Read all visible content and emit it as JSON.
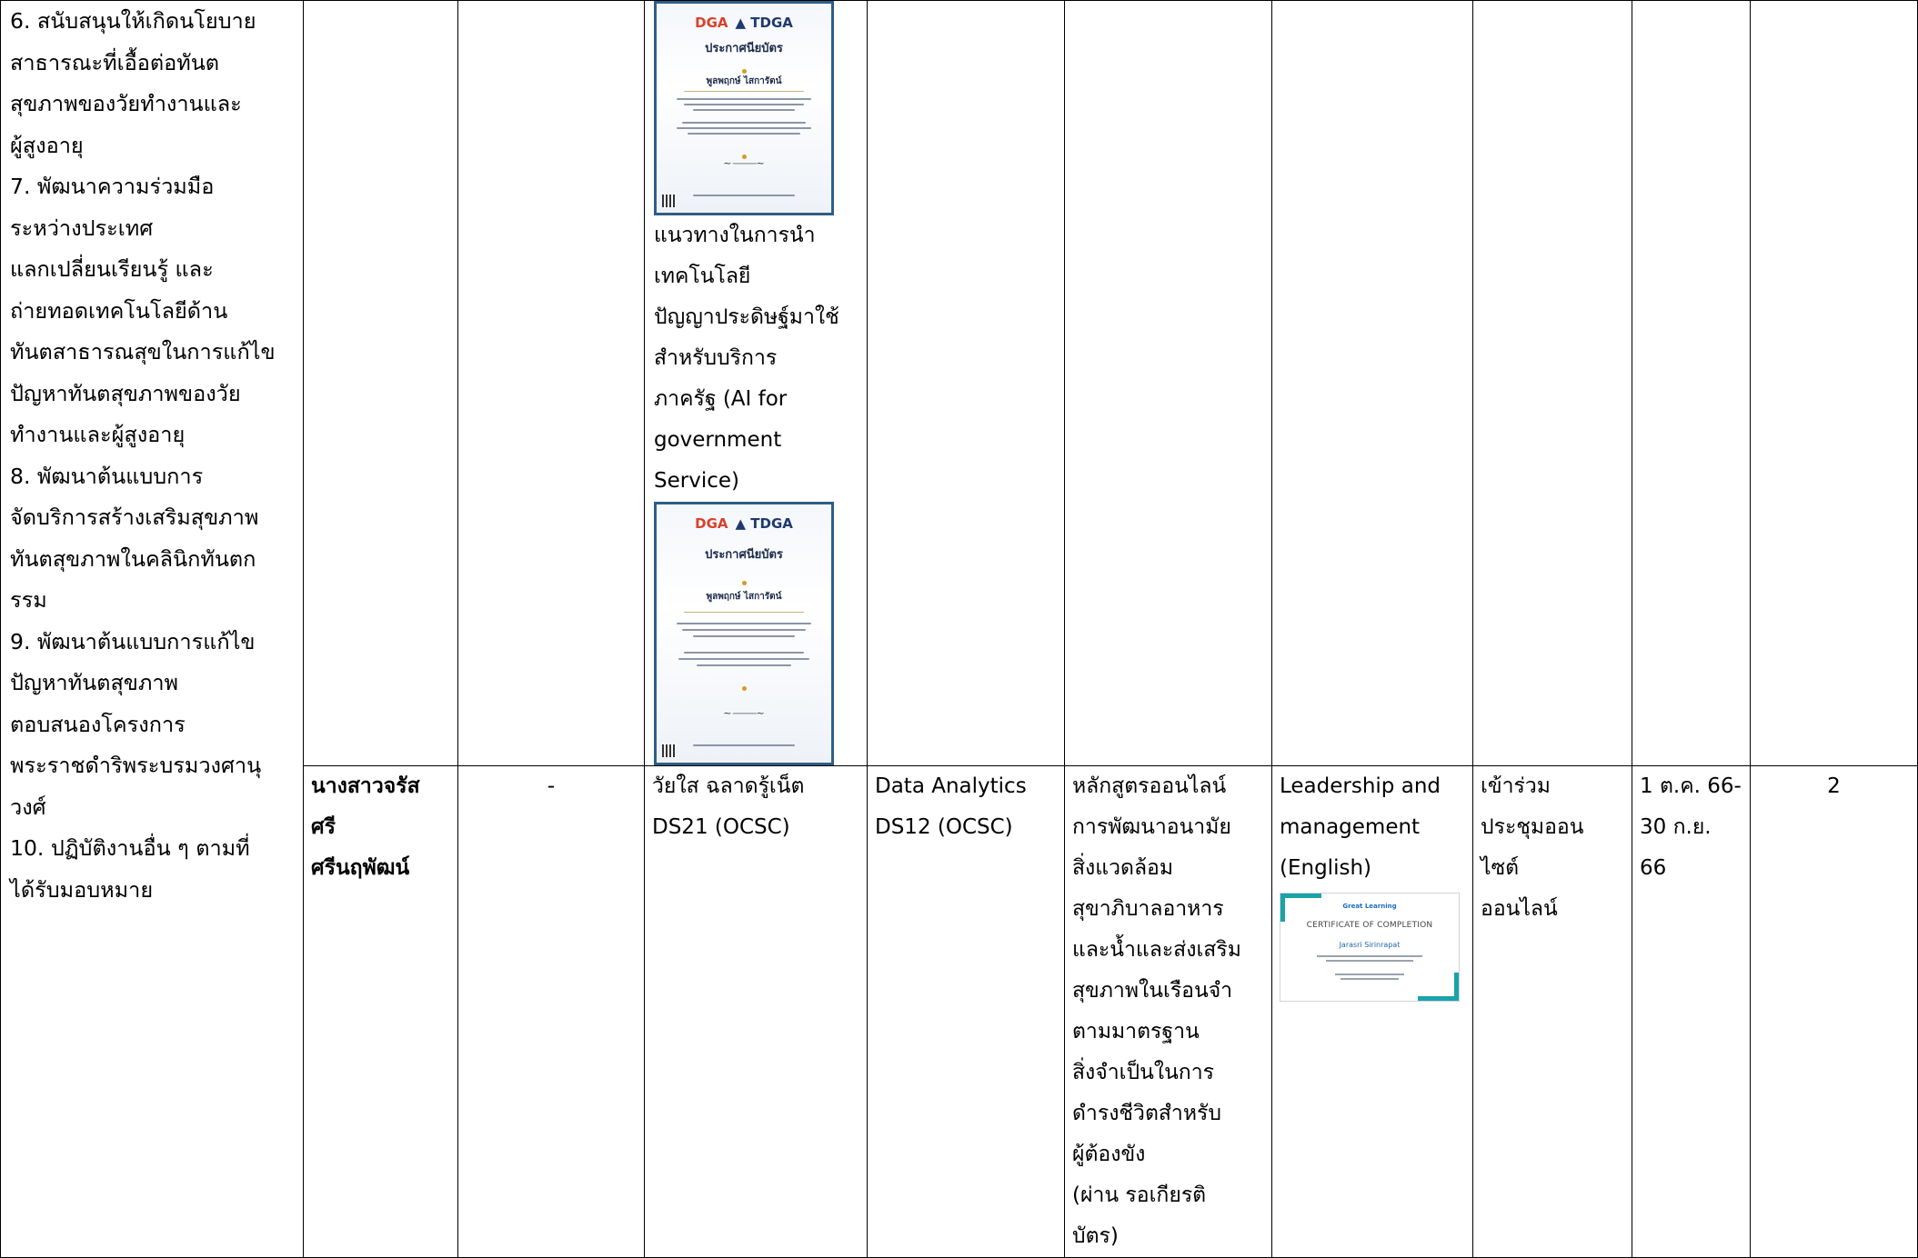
{
  "row1": {
    "col1_lines": [
      "6. สนับสนุนให้เกิดนโยบาย",
      "สาธารณะที่เอื้อต่อทันต",
      "สุขภาพของวัยทำงานและ",
      "ผู้สูงอายุ",
      "7. พัฒนาความร่วมมือ",
      "ระหว่างประเทศ",
      "แลกเปลี่ยนเรียนรู้ และ",
      "ถ่ายทอดเทคโนโลยีด้าน",
      "ทันตสาธารณสุขในการแก้ไข",
      "ปัญหาทันตสุขภาพของวัย",
      "ทำงานและผู้สูงอายุ",
      "8. พัฒนาต้นแบบการ",
      "จัดบริการสร้างเสริมสุขภาพ",
      "ทันตสุขภาพในคลินิกทันตก",
      "รรม",
      "9. พัฒนาต้นแบบการแก้ไข",
      "ปัญหาทันตสุขภาพ",
      "ตอบสนองโครงการ",
      "พระราชดำริพระบรมวงศานุ",
      "วงศ์",
      "10. ปฏิบัติงานอื่น ๆ ตามที่",
      "ได้รับมอบหมาย"
    ],
    "col4_text_lines": [
      "แนวทางในการนำ",
      "เทคโนโลยี",
      "ปัญญาประดิษฐ์มาใช้",
      "สำหรับบริการ",
      "ภาครัฐ (AI for",
      "government",
      "Service)"
    ]
  },
  "certificate": {
    "logo_left": "DGA",
    "logo_right": "TDGA",
    "title": "ประกาศนียบัตร",
    "recipient": "พูลพฤกษ์ ไสการัตน์"
  },
  "row2": {
    "name_lines": [
      "นางสาวจรัส",
      "ศรี",
      "ศรีนฤพัฒน์"
    ],
    "col3": "-",
    "col4_lines": [
      "วัยใส ฉลาดรู้เน็ต",
      "DS21 (OCSC)"
    ],
    "col5_lines": [
      "Data Analytics",
      "DS12 (OCSC)"
    ],
    "col6_lines": [
      "หลักสูตรออนไลน์",
      "การพัฒนาอนามัย",
      "สิ่งแวดล้อม",
      "สุขาภิบาลอาหาร",
      "และน้ำและส่งเสริม",
      "สุขภาพในเรือนจำ",
      "ตามมาตรฐาน",
      "สิ่งจำเป็นในการ",
      "ดำรงชีวิตสำหรับ",
      "ผู้ต้องขัง",
      "(ผ่าน รอเกียรติ",
      "บัตร)"
    ],
    "col7_lines": [
      "Leadership and",
      "management",
      "(English)"
    ],
    "col8_lines": [
      "เข้าร่วม",
      "ประชุมออน",
      "ไซต์",
      "ออนไลน์"
    ],
    "col9_lines": [
      "1 ต.ค. 66-",
      "30 ก.ย. 66"
    ],
    "col10": "2"
  },
  "gl_certificate": {
    "brand": "Great Learning",
    "title": "CERTIFICATE OF COMPLETION",
    "recipient": "Jarasri Sirinrapat"
  }
}
